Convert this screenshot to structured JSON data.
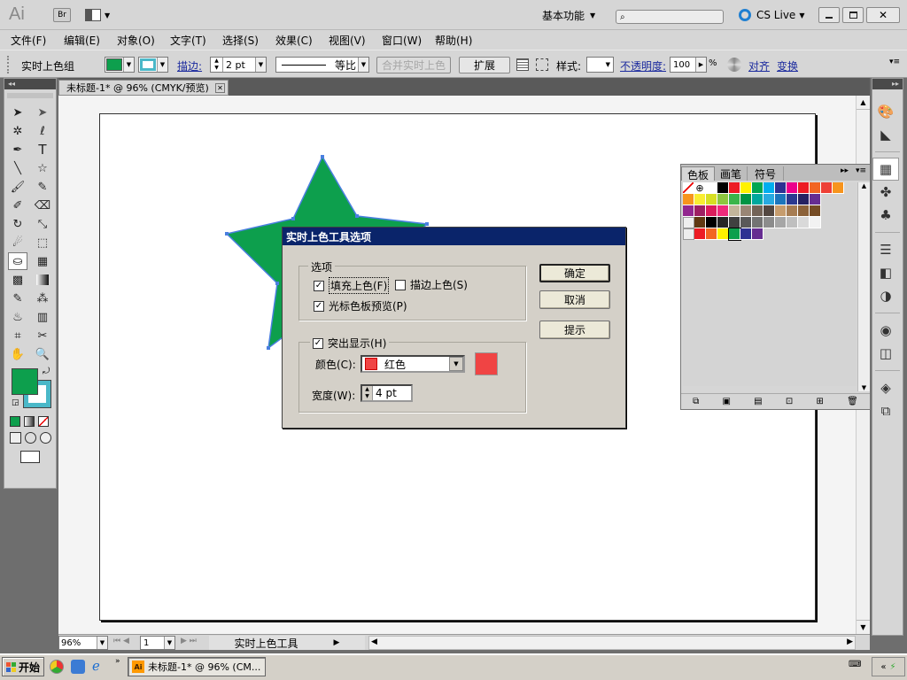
{
  "app": {
    "logo": "Ai",
    "bridge": "Br",
    "workspace": "基本功能",
    "search_placeholder": "",
    "cslive": "CS Live"
  },
  "menu": [
    "文件(F)",
    "编辑(E)",
    "对象(O)",
    "文字(T)",
    "选择(S)",
    "效果(C)",
    "视图(V)",
    "窗口(W)",
    "帮助(H)"
  ],
  "control": {
    "object_type": "实时上色组",
    "stroke_label": "描边:",
    "stroke_value": "2 pt",
    "stroke_style": "等比",
    "merge_btn": "合并实时上色",
    "expand_btn": "扩展",
    "style_label": "样式:",
    "opacity_label": "不透明度:",
    "opacity_value": "100",
    "opacity_unit": "%",
    "align": "对齐",
    "transform": "变换"
  },
  "doc": {
    "tab": "未标题-1* @ 96% (CMYK/预览)"
  },
  "status": {
    "zoom": "96%",
    "page": "1",
    "tool": "实时上色工具"
  },
  "panel": {
    "tabs": [
      "色板",
      "画笔",
      "符号"
    ]
  },
  "swatches": {
    "row1": [
      "#ffffff",
      "#000000",
      "#ed1c24",
      "#fff200",
      "#00a651",
      "#00aeef",
      "#2e3192",
      "#ec008c",
      "#ed1c24",
      "#f26522",
      "#ee4036",
      "#f7941d"
    ],
    "row2": [
      "#f7941d",
      "#f9ed32",
      "#d7df23",
      "#8dc63f",
      "#39b54a",
      "#009444",
      "#00a79d",
      "#27aae1",
      "#1c75bc",
      "#2b3990",
      "#262262",
      "#662d91"
    ],
    "row3": [
      "#92278f",
      "#9e1f63",
      "#da1c5c",
      "#ee2a7b",
      "#c2b59b",
      "#998675",
      "#736357",
      "#534741",
      "#c69c6d",
      "#a67c52",
      "#8c6239",
      "#754c24"
    ],
    "row4": [
      "#603913",
      "#000000",
      "#262626",
      "#404040",
      "#595959",
      "#737373",
      "#8c8c8c",
      "#a6a6a6",
      "#bfbfbf",
      "#d9d9d9",
      "#f2f2f2"
    ],
    "row5": [
      "#ed1c24",
      "#f26522",
      "#fff200",
      "#0d9f4d",
      "#2e3192",
      "#662d91"
    ]
  },
  "dialog": {
    "title": "实时上色工具选项",
    "options_group": "选项",
    "fill_paint": "填充上色(F)",
    "stroke_paint": "描边上色(S)",
    "cursor_preview": "光标色板预览(P)",
    "highlight": "突出显示(H)",
    "color_label": "颜色(C):",
    "color_name": "红色",
    "width_label": "宽度(W):",
    "width_value": "4 pt",
    "ok": "确定",
    "cancel": "取消",
    "tips": "提示"
  },
  "taskbar": {
    "start": "开始",
    "task": "未标题-1* @ 96% (CM..."
  },
  "colors": {
    "star_fill": "#0d9f4d",
    "star_stroke": "#4a7fe0",
    "highlight": "#f04444",
    "dialog_title_bg": "#0a246a"
  }
}
